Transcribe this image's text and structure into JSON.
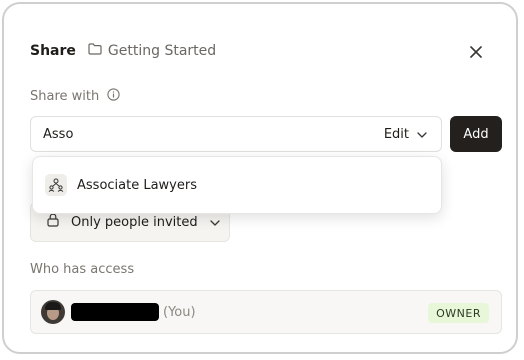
{
  "dialog": {
    "title": "Share",
    "breadcrumb_folder": "Getting Started"
  },
  "share": {
    "label": "Share with",
    "input_value": "Asso",
    "permission": "Edit",
    "add_label": "Add"
  },
  "suggestions": [
    {
      "label": "Associate Lawyers",
      "icon": "group-icon"
    }
  ],
  "access_control": {
    "label": "Only people invited",
    "icon": "lock-icon"
  },
  "access": {
    "heading": "Who has access",
    "members": [
      {
        "you_label": "(You)",
        "role": "OWNER"
      }
    ]
  },
  "colors": {
    "add_button": "#23201d",
    "owner_badge": "#e7f7d8"
  }
}
